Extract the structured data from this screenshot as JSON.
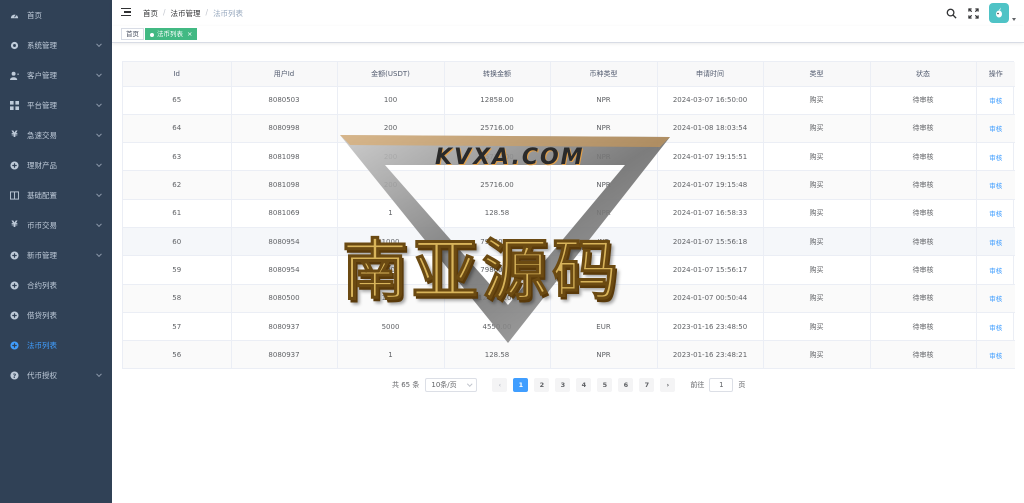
{
  "sidebar": {
    "items": [
      {
        "label": "首页",
        "icon": "dashboard-icon",
        "arrow": false,
        "active": false
      },
      {
        "label": "系统管理",
        "icon": "gear-icon",
        "arrow": true,
        "active": false
      },
      {
        "label": "客户管理",
        "icon": "user-icon",
        "arrow": true,
        "active": false
      },
      {
        "label": "平台管理",
        "icon": "grid-icon",
        "arrow": true,
        "active": false
      },
      {
        "label": "急速交易",
        "icon": "yen-icon",
        "arrow": true,
        "active": false
      },
      {
        "label": "理财产品",
        "icon": "plus-circle-icon",
        "arrow": true,
        "active": false
      },
      {
        "label": "基础配置",
        "icon": "book-icon",
        "arrow": true,
        "active": false
      },
      {
        "label": "币币交易",
        "icon": "yen-icon",
        "arrow": true,
        "active": false
      },
      {
        "label": "新币管理",
        "icon": "plus-circle-icon",
        "arrow": true,
        "active": false
      },
      {
        "label": "合约列表",
        "icon": "plus-circle-icon",
        "arrow": false,
        "active": false
      },
      {
        "label": "借贷列表",
        "icon": "plus-circle-icon",
        "arrow": false,
        "active": false
      },
      {
        "label": "法币列表",
        "icon": "plus-circle-icon",
        "arrow": false,
        "active": true
      },
      {
        "label": "代币授权",
        "icon": "question-circle-icon",
        "arrow": true,
        "active": false
      }
    ]
  },
  "breadcrumb": {
    "items": [
      "首页",
      "法币管理",
      "法币列表"
    ]
  },
  "tags": {
    "home": "首页",
    "current": "法币列表",
    "close": "×"
  },
  "table": {
    "headers": [
      "Id",
      "用户Id",
      "金额(USDT)",
      "转换金额",
      "币种类型",
      "申请时间",
      "类型",
      "状态",
      "操作"
    ],
    "rows": [
      {
        "id": "65",
        "user_id": "8080503",
        "amount": "100",
        "converted": "12858.00",
        "currency": "NPR",
        "time": "2024-03-07 16:50:00",
        "type": "购买",
        "status": "待审核",
        "action": "审核"
      },
      {
        "id": "64",
        "user_id": "8080998",
        "amount": "200",
        "converted": "25716.00",
        "currency": "NPR",
        "time": "2024-01-08 18:03:54",
        "type": "购买",
        "status": "待审核",
        "action": "审核"
      },
      {
        "id": "63",
        "user_id": "8081098",
        "amount": "200",
        "converted": "25716.00",
        "currency": "NPR",
        "time": "2024-01-07 19:15:51",
        "type": "购买",
        "status": "待审核",
        "action": "审核"
      },
      {
        "id": "62",
        "user_id": "8081098",
        "amount": "200",
        "converted": "25716.00",
        "currency": "NPR",
        "time": "2024-01-07 19:15:48",
        "type": "购买",
        "status": "待审核",
        "action": "审核"
      },
      {
        "id": "61",
        "user_id": "8081069",
        "amount": "1",
        "converted": "128.58",
        "currency": "NPR",
        "time": "2024-01-07 16:58:33",
        "type": "购买",
        "status": "待审核",
        "action": "审核"
      },
      {
        "id": "60",
        "user_id": "8080954",
        "amount": "1000",
        "converted": "79860.00",
        "currency": "INR",
        "time": "2024-01-07 15:56:18",
        "type": "购买",
        "status": "待审核",
        "action": "审核"
      },
      {
        "id": "59",
        "user_id": "8080954",
        "amount": "1000",
        "converted": "79860.00",
        "currency": "INR",
        "time": "2024-01-07 15:56:17",
        "type": "购买",
        "status": "待审核",
        "action": "审核"
      },
      {
        "id": "58",
        "user_id": "8080500",
        "amount": "1000",
        "converted": "128581.00",
        "currency": "NPR",
        "time": "2024-01-07 00:50:44",
        "type": "购买",
        "status": "待审核",
        "action": "审核"
      },
      {
        "id": "57",
        "user_id": "8080937",
        "amount": "5000",
        "converted": "4550.00",
        "currency": "EUR",
        "time": "2023-01-16 23:48:50",
        "type": "购买",
        "status": "待审核",
        "action": "审核"
      },
      {
        "id": "56",
        "user_id": "8080937",
        "amount": "1",
        "converted": "128.58",
        "currency": "NPR",
        "time": "2023-01-16 23:48:21",
        "type": "购买",
        "status": "待审核",
        "action": "审核"
      }
    ]
  },
  "pagination": {
    "total": "共 65 条",
    "page_size": "10条/页",
    "prev": "‹",
    "next": "›",
    "pages": [
      "1",
      "2",
      "3",
      "4",
      "5",
      "6",
      "7"
    ],
    "current": "1",
    "goto_prefix": "前往",
    "goto_value": "1",
    "goto_suffix": "页"
  },
  "watermark": {
    "url_text": "KVXA.COM",
    "title": "南亚源码"
  },
  "colors": {
    "sidebar_bg": "#304156",
    "sidebar_text": "#bfcbd9",
    "active": "#409eff",
    "tag_active": "#42b983",
    "avatar_bg": "#4fc3c6"
  }
}
